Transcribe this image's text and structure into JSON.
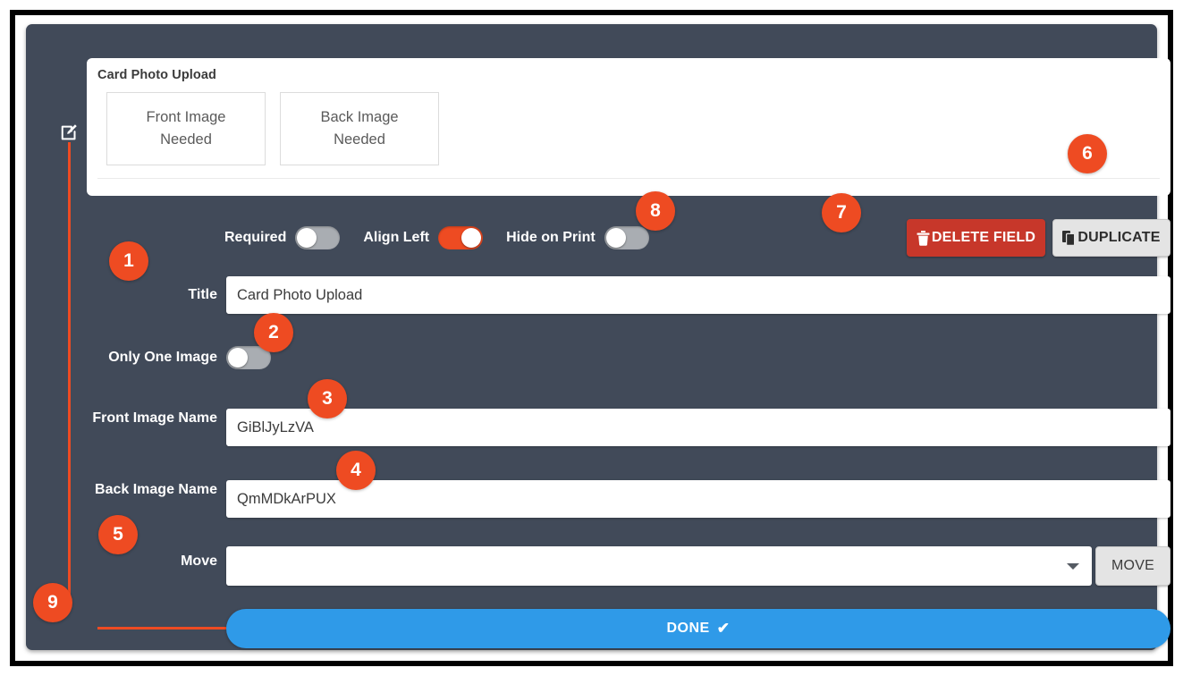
{
  "preview": {
    "title": "Card Photo Upload",
    "front_slot": "Front Image\nNeeded",
    "front_slot_line1": "Front Image",
    "front_slot_line2": "Needed",
    "back_slot_line1": "Back Image",
    "back_slot_line2": "Needed"
  },
  "toggles": {
    "required": {
      "label": "Required",
      "state": "off"
    },
    "align_left": {
      "label": "Align Left",
      "state": "on"
    },
    "hide_on_print": {
      "label": "Hide on Print",
      "state": "off"
    },
    "only_one_image": {
      "label": "Only One Image",
      "state": "off"
    }
  },
  "actions": {
    "delete_field": "DELETE FIELD",
    "duplicate": "DUPLICATE",
    "move": "MOVE",
    "done": "DONE",
    "done_check": "✔"
  },
  "fields": {
    "title": {
      "label": "Title",
      "value": "Card Photo Upload",
      "placeholder": ""
    },
    "front_image_name": {
      "label": "Front Image Name",
      "value": "GiBlJyLzVA",
      "placeholder": ""
    },
    "back_image_name": {
      "label": "Back Image Name",
      "value": "QmMDkArPUX",
      "placeholder": ""
    },
    "move": {
      "label": "Move",
      "value": "",
      "placeholder": ""
    }
  },
  "badges": {
    "b1": "1",
    "b2": "2",
    "b3": "3",
    "b4": "4",
    "b5": "5",
    "b6": "6",
    "b7": "7",
    "b8": "8",
    "b9": "9"
  },
  "colors": {
    "accent_orange": "#ee4b22",
    "panel_dark": "#414a59",
    "delete_red": "#c7372a",
    "done_blue": "#2f9ae8",
    "toggle_off": "#a9adb2"
  }
}
